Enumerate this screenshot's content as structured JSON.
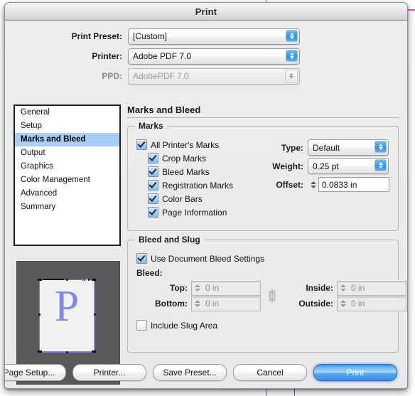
{
  "window": {
    "title": "Print"
  },
  "top_settings": [
    {
      "label": "Print Preset:",
      "value": "[Custom]",
      "disabled": false,
      "name": "print-preset"
    },
    {
      "label": "Printer:",
      "value": "Adobe PDF 7.0",
      "disabled": false,
      "name": "printer"
    },
    {
      "label": "PPD:",
      "value": "AdobePDF 7.0",
      "disabled": true,
      "name": "ppd"
    }
  ],
  "sidebar": {
    "items": [
      {
        "label": "General",
        "selected": false
      },
      {
        "label": "Setup",
        "selected": false
      },
      {
        "label": "Marks and Bleed",
        "selected": true
      },
      {
        "label": "Output",
        "selected": false
      },
      {
        "label": "Graphics",
        "selected": false
      },
      {
        "label": "Color Management",
        "selected": false
      },
      {
        "label": "Advanced",
        "selected": false
      },
      {
        "label": "Summary",
        "selected": false
      }
    ]
  },
  "preview": {
    "page_letter": "P"
  },
  "panel": {
    "title": "Marks and Bleed",
    "marks_group": {
      "title": "Marks",
      "checkboxes": [
        {
          "label": "All Printer's Marks",
          "checked": true,
          "indent": 0
        },
        {
          "label": "Crop Marks",
          "checked": true,
          "indent": 1
        },
        {
          "label": "Bleed Marks",
          "checked": true,
          "indent": 1
        },
        {
          "label": "Registration Marks",
          "checked": true,
          "indent": 1
        },
        {
          "label": "Color Bars",
          "checked": true,
          "indent": 1
        },
        {
          "label": "Page Information",
          "checked": true,
          "indent": 1
        }
      ],
      "type": {
        "label": "Type:",
        "value": "Default"
      },
      "weight": {
        "label": "Weight:",
        "value": "0.25 pt"
      },
      "offset": {
        "label": "Offset:",
        "value": "0.0833 in"
      }
    },
    "bleed_group": {
      "title": "Bleed and Slug",
      "use_document_bleed": {
        "label": "Use Document Bleed Settings",
        "checked": true
      },
      "bleed_label": "Bleed:",
      "fields": [
        {
          "label": "Top:",
          "value": "0 in",
          "disabled": true
        },
        {
          "label": "Bottom:",
          "value": "0 in",
          "disabled": true
        },
        {
          "label": "Inside:",
          "value": "0 in",
          "disabled": true
        },
        {
          "label": "Outside:",
          "value": "0 in",
          "disabled": true
        }
      ],
      "include_slug": {
        "label": "Include Slug Area",
        "checked": false
      }
    }
  },
  "buttons": [
    {
      "label": "Page Setup...",
      "name": "page-setup-button",
      "primary": false
    },
    {
      "label": "Printer...",
      "name": "printer-button",
      "primary": false
    },
    {
      "label": "Save Preset...",
      "name": "save-preset-button",
      "primary": false
    },
    {
      "label": "Cancel",
      "name": "cancel-button",
      "primary": false
    },
    {
      "label": "Print",
      "name": "print-button",
      "primary": true
    }
  ],
  "colors": {
    "selection_blue": "#a8cdf7",
    "primary_button": "#3b8ee2",
    "preview_background": "#595959",
    "page_letter": "#8188e8",
    "guide_magenta": "#e34ee0",
    "guide_violet": "#6b6b8f"
  }
}
